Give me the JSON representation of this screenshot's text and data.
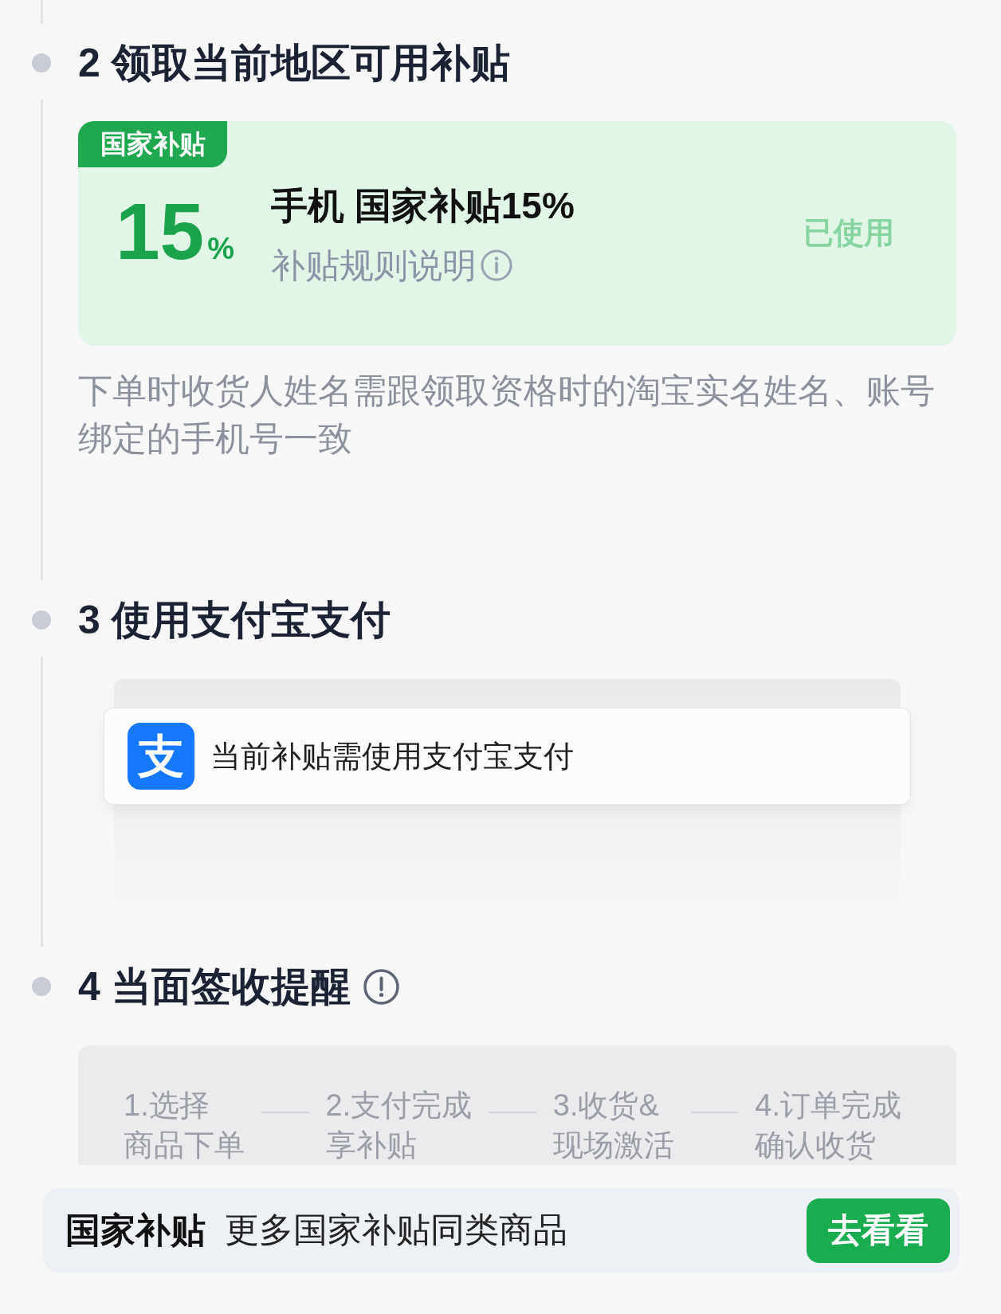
{
  "steps": [
    {
      "kind": "subsidy",
      "title": "2 领取当前地区可用补贴",
      "card": {
        "badge": "国家补贴",
        "amount": "15",
        "unit": "%",
        "title": "手机 国家补贴15%",
        "rules_link": "补贴规则说明",
        "status": "已使用"
      },
      "note": "下单时收货人姓名需跟领取资格时的淘宝实名姓名、账号绑定的手机号一致"
    },
    {
      "kind": "payment",
      "title": "3 使用支付宝支付",
      "notice": {
        "logo": "支",
        "text": "当前补贴需使用支付宝支付"
      }
    },
    {
      "kind": "delivery",
      "title": "4 当面签收提醒",
      "process": [
        {
          "label": "1.选择",
          "detail": "商品下单"
        },
        {
          "label": "2.支付完成",
          "detail": "享补贴"
        },
        {
          "label": "3.收货&",
          "detail": "现场激活"
        },
        {
          "label": "4.订单完成",
          "detail": "确认收货"
        }
      ]
    }
  ],
  "promo_bar": {
    "brand": "国家补贴",
    "text": "更多国家补贴同类商品",
    "button": "去看看"
  }
}
